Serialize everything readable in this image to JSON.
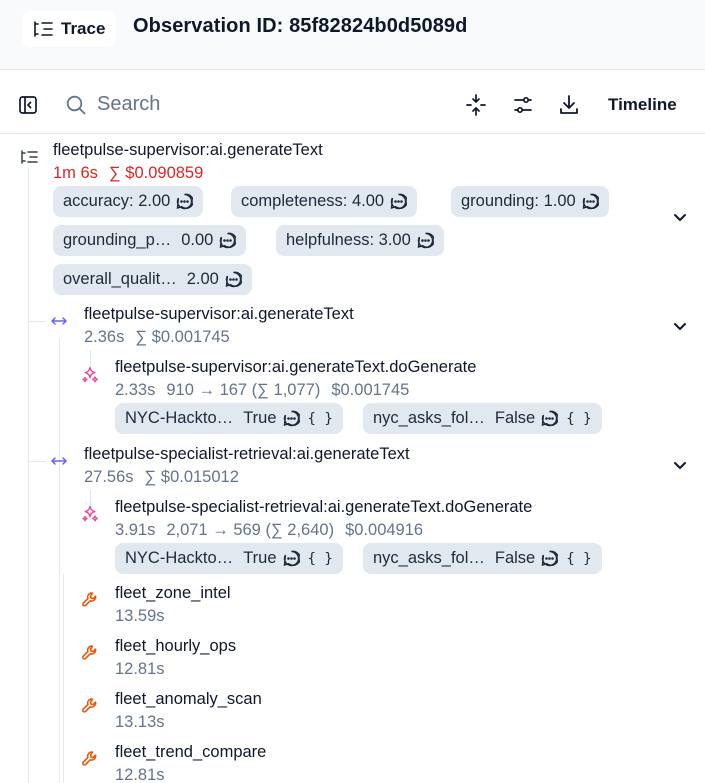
{
  "header": {
    "trace_label": "Trace",
    "observation_id": "Observation ID: 85f82824b0d5089d"
  },
  "toolbar": {
    "search_placeholder": "Search",
    "timeline_label": "Timeline"
  },
  "root": {
    "name": "fleetpulse-supervisor:ai.generateText",
    "duration": "1m 6s",
    "cost": "∑ $0.090859",
    "scores": [
      {
        "label": "accuracy: 2.00"
      },
      {
        "label": "completeness: 4.00"
      },
      {
        "label": "grounding: 1.00"
      },
      {
        "label": "grounding_p…",
        "value": "0.00"
      },
      {
        "label": "helpfulness: 3.00"
      },
      {
        "label": "overall_qualit…",
        "value": "2.00"
      }
    ]
  },
  "child1": {
    "name": "fleetpulse-supervisor:ai.generateText",
    "duration": "2.36s",
    "cost": "∑ $0.001745",
    "gen": {
      "name": "fleetpulse-supervisor:ai.generateText.doGenerate",
      "duration": "2.33s",
      "tokens": "910 → 167 (∑ 1,077)",
      "cost": "$0.001745",
      "tags": [
        {
          "label": "NYC-Hackto…",
          "value": "True",
          "braces": "{ }"
        },
        {
          "label": "nyc_asks_fol…",
          "value": "False",
          "braces": "{ }"
        }
      ]
    }
  },
  "child2": {
    "name": "fleetpulse-specialist-retrieval:ai.generateText",
    "duration": "27.56s",
    "cost": "∑ $0.015012",
    "gen": {
      "name": "fleetpulse-specialist-retrieval:ai.generateText.doGenerate",
      "duration": "3.91s",
      "tokens": "2,071 → 569 (∑ 2,640)",
      "cost": "$0.004916",
      "tags": [
        {
          "label": "NYC-Hackto…",
          "value": "True",
          "braces": "{ }"
        },
        {
          "label": "nyc_asks_fol…",
          "value": "False",
          "braces": "{ }"
        }
      ]
    },
    "tools": [
      {
        "name": "fleet_zone_intel",
        "duration": "13.59s"
      },
      {
        "name": "fleet_hourly_ops",
        "duration": "12.81s"
      },
      {
        "name": "fleet_anomaly_scan",
        "duration": "13.13s"
      },
      {
        "name": "fleet_trend_compare",
        "duration": "12.81s"
      }
    ]
  },
  "colors": {
    "span_icon": "#6366f1",
    "generation_icon": "#ec4899",
    "tool_icon": "#ea580c",
    "cost_red": "#dc2626",
    "pill_bg": "#e2e8f0"
  }
}
